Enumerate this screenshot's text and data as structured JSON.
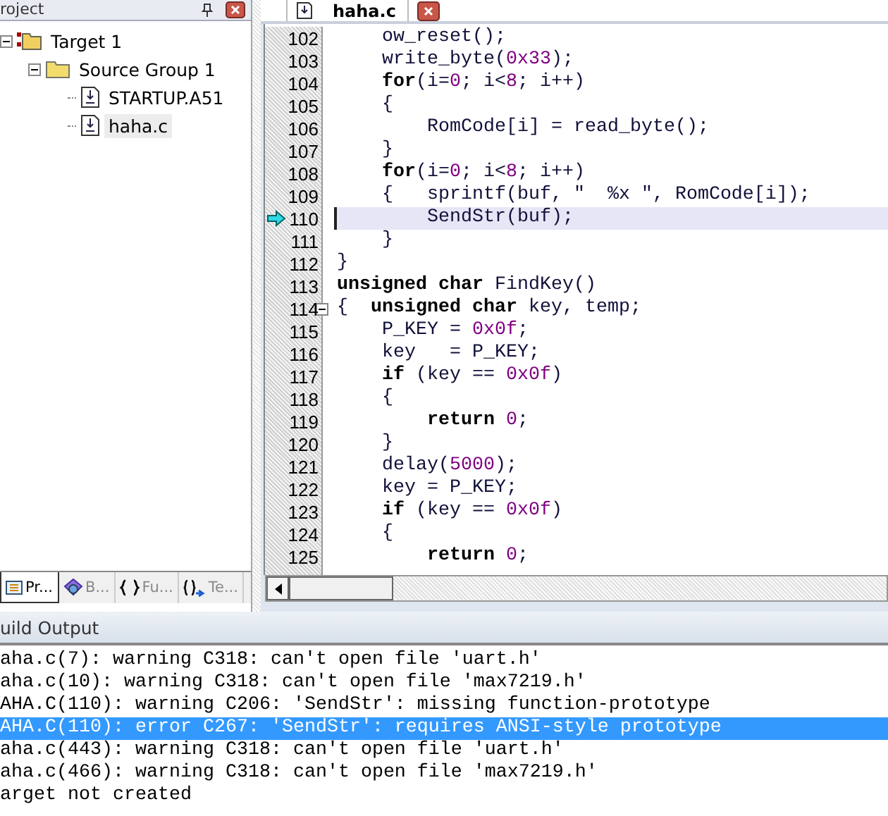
{
  "project_panel": {
    "title": "roject",
    "tree": [
      {
        "label": "Target 1",
        "kind": "target",
        "selected": false,
        "expanded": true,
        "children": [
          {
            "label": "Source Group 1",
            "kind": "folder",
            "selected": false,
            "expanded": true,
            "children": [
              {
                "label": "STARTUP.A51",
                "kind": "file",
                "selected": false
              },
              {
                "label": "haha.c",
                "kind": "file",
                "selected": true
              }
            ]
          }
        ]
      }
    ],
    "tabs": [
      {
        "label": "Pr...",
        "kind": "project",
        "selected": true
      },
      {
        "label": "B...",
        "kind": "books",
        "selected": false
      },
      {
        "label": "Fu...",
        "kind": "braces",
        "selected": false
      },
      {
        "label": "Te...",
        "kind": "template",
        "selected": false
      }
    ]
  },
  "editor": {
    "tab": {
      "label": "haha.c",
      "selected": true
    },
    "lines": [
      {
        "number": "102",
        "current": false,
        "fold_box": false,
        "segments": [
          {
            "text": "    ow_reset();",
            "kind": "plain"
          }
        ]
      },
      {
        "number": "103",
        "current": false,
        "fold_box": false,
        "segments": [
          {
            "text": "    write_byte(",
            "kind": "plain"
          },
          {
            "text": "0x33",
            "kind": "num"
          },
          {
            "text": ");",
            "kind": "plain"
          }
        ]
      },
      {
        "number": "104",
        "current": false,
        "fold_box": false,
        "segments": [
          {
            "text": "    for",
            "kind": "kw"
          },
          {
            "text": "(i=",
            "kind": "plain"
          },
          {
            "text": "0",
            "kind": "num"
          },
          {
            "text": "; i<",
            "kind": "plain"
          },
          {
            "text": "8",
            "kind": "num"
          },
          {
            "text": "; i++)",
            "kind": "plain"
          }
        ]
      },
      {
        "number": "105",
        "current": false,
        "fold_box": false,
        "segments": [
          {
            "text": "    {",
            "kind": "plain"
          }
        ]
      },
      {
        "number": "106",
        "current": false,
        "fold_box": false,
        "segments": [
          {
            "text": "        RomCode[i] = read_byte();",
            "kind": "plain"
          }
        ]
      },
      {
        "number": "107",
        "current": false,
        "fold_box": false,
        "segments": [
          {
            "text": "    }",
            "kind": "plain"
          }
        ]
      },
      {
        "number": "108",
        "current": false,
        "fold_box": false,
        "segments": [
          {
            "text": "    for",
            "kind": "kw"
          },
          {
            "text": "(i=",
            "kind": "plain"
          },
          {
            "text": "0",
            "kind": "num"
          },
          {
            "text": "; i<",
            "kind": "plain"
          },
          {
            "text": "8",
            "kind": "num"
          },
          {
            "text": "; i++)",
            "kind": "plain"
          }
        ]
      },
      {
        "number": "109",
        "current": false,
        "fold_box": false,
        "segments": [
          {
            "text": "    {   sprintf(buf, \"  %x \", RomCode[i]);",
            "kind": "plain"
          }
        ]
      },
      {
        "number": "110",
        "current": true,
        "fold_box": false,
        "segments": [
          {
            "text": "        SendStr(buf);",
            "kind": "plain"
          }
        ]
      },
      {
        "number": "111",
        "current": false,
        "fold_box": false,
        "segments": [
          {
            "text": "    }",
            "kind": "plain"
          }
        ]
      },
      {
        "number": "112",
        "current": false,
        "fold_box": false,
        "segments": [
          {
            "text": "}",
            "kind": "plain"
          }
        ]
      },
      {
        "number": "113",
        "current": false,
        "fold_box": false,
        "segments": [
          {
            "text": "unsigned char",
            "kind": "kw"
          },
          {
            "text": " FindKey()",
            "kind": "plain"
          }
        ]
      },
      {
        "number": "114",
        "current": false,
        "fold_box": true,
        "segments": [
          {
            "text": "{  ",
            "kind": "plain"
          },
          {
            "text": "unsigned char",
            "kind": "kw"
          },
          {
            "text": " key, temp;",
            "kind": "plain"
          }
        ]
      },
      {
        "number": "115",
        "current": false,
        "fold_box": false,
        "segments": [
          {
            "text": "    P_KEY = ",
            "kind": "plain"
          },
          {
            "text": "0x0f",
            "kind": "num"
          },
          {
            "text": ";",
            "kind": "plain"
          }
        ]
      },
      {
        "number": "116",
        "current": false,
        "fold_box": false,
        "segments": [
          {
            "text": "    key   = P_KEY;",
            "kind": "plain"
          }
        ]
      },
      {
        "number": "117",
        "current": false,
        "fold_box": false,
        "segments": [
          {
            "text": "    if",
            "kind": "kw"
          },
          {
            "text": " (key == ",
            "kind": "plain"
          },
          {
            "text": "0x0f",
            "kind": "num"
          },
          {
            "text": ")",
            "kind": "plain"
          }
        ]
      },
      {
        "number": "118",
        "current": false,
        "fold_box": false,
        "segments": [
          {
            "text": "    {",
            "kind": "plain"
          }
        ]
      },
      {
        "number": "119",
        "current": false,
        "fold_box": false,
        "segments": [
          {
            "text": "        return",
            "kind": "kw"
          },
          {
            "text": " 0",
            "kind": "num"
          },
          {
            "text": ";",
            "kind": "plain"
          }
        ]
      },
      {
        "number": "120",
        "current": false,
        "fold_box": false,
        "segments": [
          {
            "text": "    }",
            "kind": "plain"
          }
        ]
      },
      {
        "number": "121",
        "current": false,
        "fold_box": false,
        "segments": [
          {
            "text": "    delay(",
            "kind": "plain"
          },
          {
            "text": "5000",
            "kind": "num"
          },
          {
            "text": ");",
            "kind": "plain"
          }
        ]
      },
      {
        "number": "122",
        "current": false,
        "fold_box": false,
        "segments": [
          {
            "text": "    key = P_KEY;",
            "kind": "plain"
          }
        ]
      },
      {
        "number": "123",
        "current": false,
        "fold_box": false,
        "segments": [
          {
            "text": "    if",
            "kind": "kw"
          },
          {
            "text": " (key == ",
            "kind": "plain"
          },
          {
            "text": "0x0f",
            "kind": "num"
          },
          {
            "text": ")",
            "kind": "plain"
          }
        ]
      },
      {
        "number": "124",
        "current": false,
        "fold_box": false,
        "segments": [
          {
            "text": "    {",
            "kind": "plain"
          }
        ]
      },
      {
        "number": "125",
        "current": false,
        "fold_box": false,
        "segments": [
          {
            "text": "        return",
            "kind": "kw"
          },
          {
            "text": " 0",
            "kind": "num"
          },
          {
            "text": ";",
            "kind": "plain"
          }
        ]
      }
    ]
  },
  "build_output": {
    "title": "uild Output",
    "lines": [
      {
        "text": "aha.c(7): warning C318: can't open file 'uart.h'",
        "selected": false
      },
      {
        "text": "aha.c(10): warning C318: can't open file 'max7219.h'",
        "selected": false
      },
      {
        "text": "AHA.C(110): warning C206: 'SendStr': missing function-prototype",
        "selected": false
      },
      {
        "text": "AHA.C(110): error C267: 'SendStr': requires ANSI-style prototype",
        "selected": true
      },
      {
        "text": "aha.c(443): warning C318: can't open file 'uart.h'",
        "selected": false
      },
      {
        "text": "aha.c(466): warning C318: can't open file 'max7219.h'",
        "selected": false
      },
      {
        "text": "arget not created",
        "selected": false
      }
    ]
  }
}
